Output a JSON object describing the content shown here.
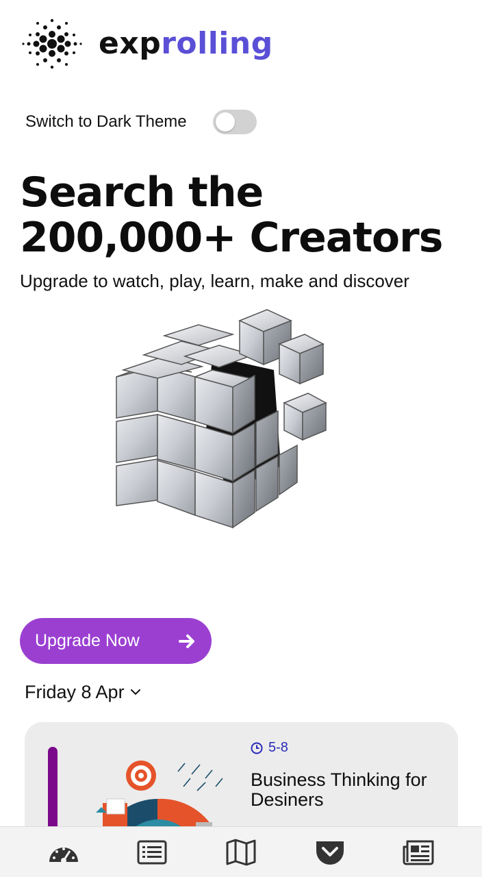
{
  "brand": {
    "name_part1": "exp",
    "name_part2": "rolling",
    "accent": "#5a4fd6"
  },
  "theme_switch": {
    "label": "Switch to Dark Theme",
    "on": false
  },
  "hero": {
    "title_line1": "Search the",
    "title_line2": "200,000+ Creators",
    "subtitle": "Upgrade to watch, play, learn, make and discover"
  },
  "cta": {
    "label": "Upgrade Now",
    "color": "#9b3fd1"
  },
  "date_selector": {
    "value": "Friday 8 Apr"
  },
  "card": {
    "time": "5-8",
    "title": "Business Thinking for Desiners",
    "accent_bar": "#7b0a8a"
  },
  "bottom_nav": {
    "items": [
      {
        "icon": "dashboard-gauge-icon"
      },
      {
        "icon": "list-icon"
      },
      {
        "icon": "map-icon"
      },
      {
        "icon": "pocket-icon"
      },
      {
        "icon": "newspaper-icon"
      }
    ]
  }
}
